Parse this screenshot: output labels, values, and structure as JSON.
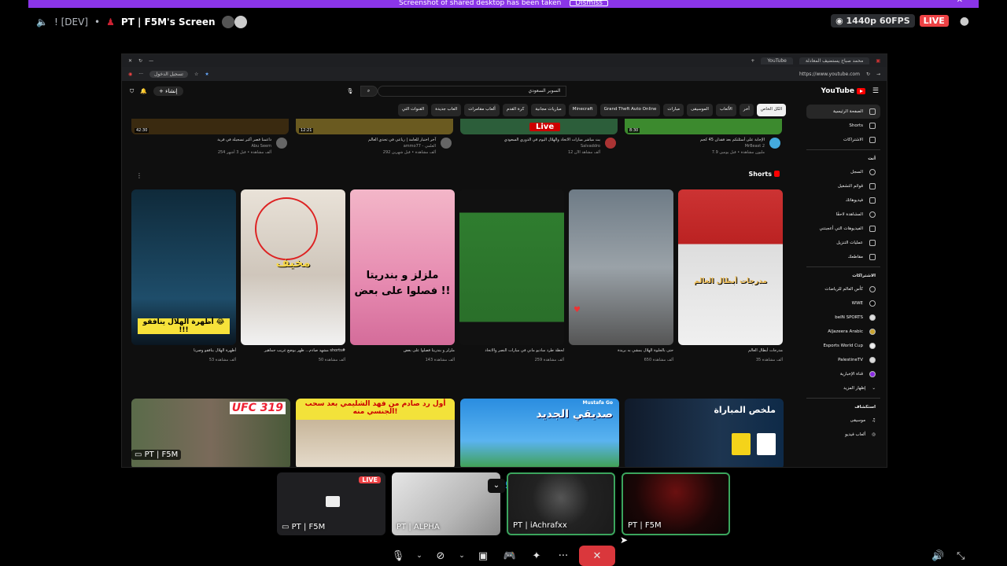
{
  "banner": {
    "text": "Screenshot of shared desktop has been taken",
    "button": "Dismiss"
  },
  "topbar": {
    "server": "! [DEV]",
    "channel_title": "PT | F5M's Screen",
    "resolution_badge": "1440p 60FPS",
    "live_badge": "LIVE"
  },
  "browser": {
    "tab_active": "YouTube",
    "tab_other": "محمد صباح يستضيف المعادلة",
    "url": "https://www.youtube.com",
    "login_button": "تسجيل الدخول"
  },
  "youtube": {
    "logo": "YouTube",
    "search_value": "السوبر السعودي",
    "create_label": "إنشاء",
    "chips": [
      "الكل الخاص",
      "آخر",
      "الألعاب",
      "الموسيقى",
      "مبارات",
      "Grand Theft Auto Online",
      "Minecraft",
      "مباريات مجانية",
      "كرة القدم",
      "ألعاب مقامرات",
      "العاب جديدة",
      "القنوات التي"
    ],
    "sidebar": {
      "items_main": [
        "الصفحة الرئيسية",
        "Shorts",
        "الاشتراكات"
      ],
      "section_you": "أنت",
      "items_you": [
        "السجل",
        "قوائم التشغيل",
        "فيديوهاتك",
        "المشاهدة لاحقًا",
        "الفيديوهات التي أعجبتني",
        "عمليات التنزيل",
        "مقاطعك"
      ],
      "section_subs": "الاشتراكات",
      "subs": [
        "كأس العالم للرياضات",
        "WWE",
        "beIN SPORTS",
        "AlJazeera Arabic",
        "Esports World Cup",
        "PalestineTV",
        "قناة الإخبارية"
      ],
      "show_more": "إظهار المزيد",
      "section_explore": "استكشاف",
      "explore": [
        "موسيقى",
        "ألعاب فيديو"
      ]
    },
    "top_videos": [
      {
        "duration": "42:30",
        "title": "داعمنا قصر أكبر تسجيلة في قرية",
        "channel": "Abu Seem",
        "stats": "254 ألف مشاهدة • قبل 3 أشهر"
      },
      {
        "duration": "12:21",
        "title": "آخر اختبار للعامة | رباعي في تحدي العالم",
        "channel": "ammo77 - العلمي",
        "stats": "292 ألف مشاهدة • قبل شهرين"
      },
      {
        "duration": "",
        "title": "بث مباشر مبارات الاتحاد والهلال اليوم في الدوري السعودي",
        "channel": "Salvaddro",
        "stats": "12 ألف مشاهد الآن",
        "live": "Live"
      },
      {
        "duration": "8:30",
        "title": "الإجابة على أسئلتكم بعد فقدان 45 كجم",
        "channel": "MrBeast 2",
        "stats": "7.9 مليون مشاهدة • قبل يومين"
      }
    ],
    "shorts_title": "Shorts",
    "shorts": [
      {
        "caption": "أظهرة الهلال ينافقو 😂 !!!",
        "title": "أظهرة الهلال ينافقو وصرنا",
        "stats": "53 ألف مشاهدة"
      },
      {
        "caption": "مخيف",
        "title": "مشهد صادم... ظهر بوضع غريب جماهير shorts#",
        "stats": "50 ألف مشاهدة"
      },
      {
        "caption": "ملزلز و بندريتا فصلوا على بعض !!",
        "title": "ملزلز و بندريتا فصلوا على بعض",
        "stats": "143 ألف مشاهدة"
      },
      {
        "caption": "",
        "title": "لحظة طرد ساديو ماني في مبارات النصر والاتحاد",
        "stats": "259 ألف مشاهدة"
      },
      {
        "caption": "",
        "title": "حتى بالجلوة الهلال يمشي به بريدة",
        "stats": "650 ألف مشاهدة"
      },
      {
        "caption": "مدرجات أبطال العالم",
        "title": "مدرجات أبطال العالم",
        "stats": "35 ألف مشاهدة"
      }
    ],
    "bottom_videos": [
      {
        "caption": "UFC 319"
      },
      {
        "caption": "أول رد صادم من فهد الشليمي بعد سحب الجنسي منه!"
      },
      {
        "caption": "صديقي الجديد",
        "channel_tag": "Mustafa Go"
      },
      {
        "caption": "ملخص المباراة"
      }
    ],
    "stream_owner": "PT | F5M"
  },
  "participants": [
    {
      "name": "PT | F5M",
      "live": "LIVE"
    },
    {
      "name": "PT | ALPHA"
    },
    {
      "name": "PT | iAchrafxx"
    },
    {
      "name": "PT | F5M"
    }
  ],
  "colors": {
    "accent": "#8b35e8",
    "live": "#ed4245",
    "speaking": "#3ba55d",
    "end_call": "#da373c",
    "youtube_red": "#ff0000"
  }
}
